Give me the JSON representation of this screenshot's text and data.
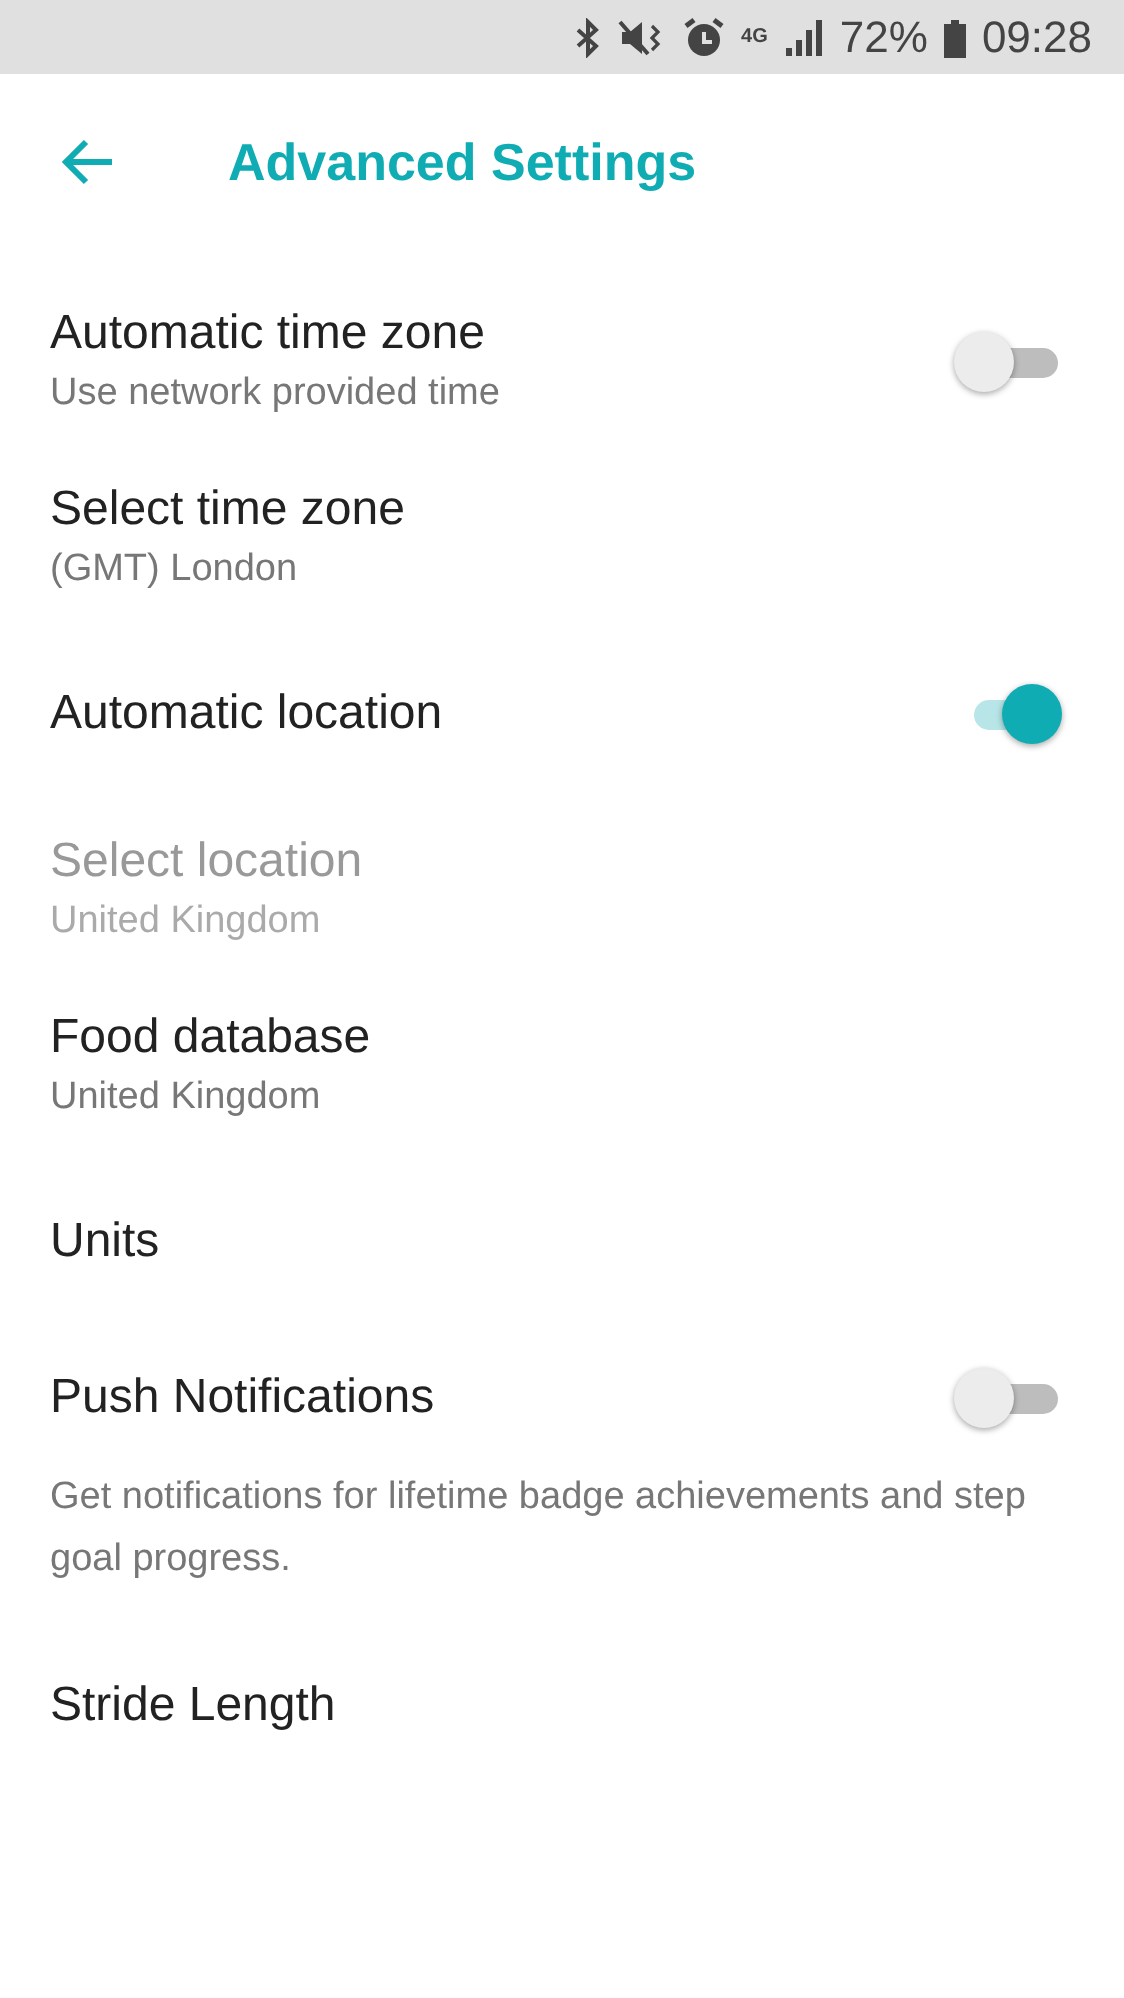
{
  "status_bar": {
    "network": "4G",
    "battery": "72%",
    "time": "09:28"
  },
  "header": {
    "title": "Advanced Settings"
  },
  "settings": [
    {
      "kind": "toggle",
      "title": "Automatic time zone",
      "subtitle": "Use network provided time",
      "on": false,
      "disabled": false
    },
    {
      "kind": "link",
      "title": "Select time zone",
      "subtitle": "(GMT) London",
      "disabled": false
    },
    {
      "kind": "toggle",
      "title": "Automatic location",
      "on": true,
      "disabled": false
    },
    {
      "kind": "link",
      "title": "Select location",
      "subtitle": "United Kingdom",
      "disabled": true
    },
    {
      "kind": "link",
      "title": "Food database",
      "subtitle": "United Kingdom",
      "disabled": false
    },
    {
      "kind": "link",
      "title": "Units",
      "disabled": false
    },
    {
      "kind": "toggle",
      "title": "Push Notifications",
      "on": false,
      "disabled": false,
      "description": "Get notifications for lifetime badge achievements and step goal progress."
    },
    {
      "kind": "link",
      "title": "Stride Length",
      "disabled": false
    }
  ]
}
